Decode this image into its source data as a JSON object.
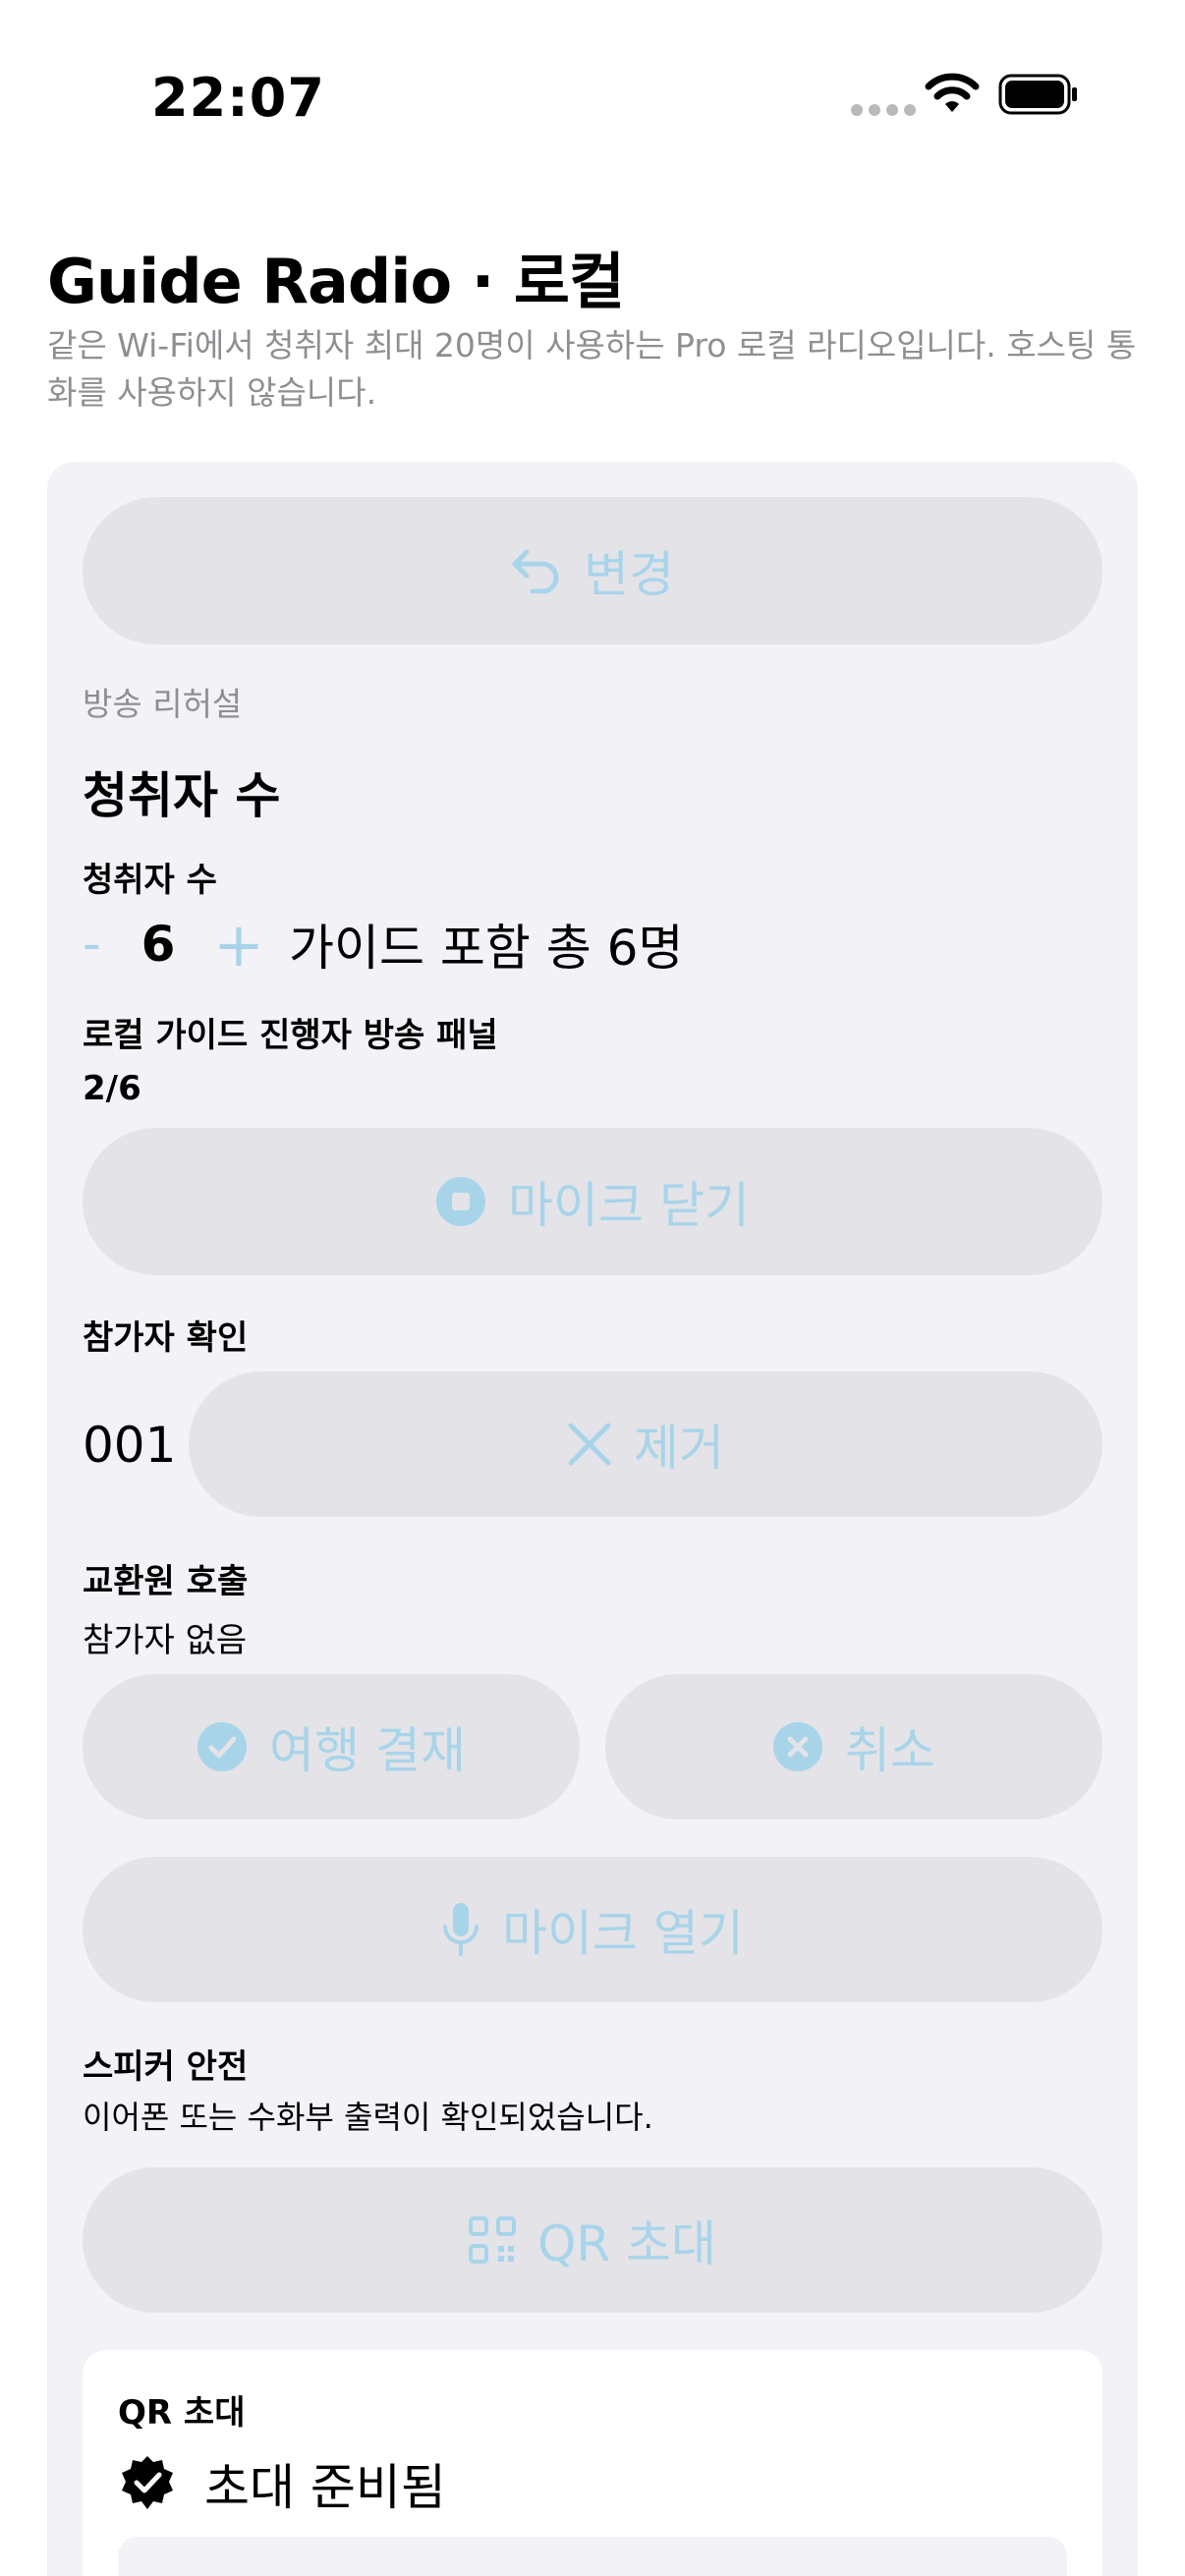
{
  "status_bar": {
    "time": "22:07"
  },
  "header": {
    "title": "Guide Radio · 로컬",
    "subtitle": "같은 Wi-Fi에서 청취자 최대 20명이 사용하는 Pro 로컬 라디오입니다. 호스팅 통화를 사용하지 않습니다."
  },
  "card": {
    "change_button": {
      "label": "변경",
      "icon": "undo-icon"
    },
    "rehearsal_caption": "방송 리허설",
    "listeners_title": "청취자 수",
    "listeners_label": "청취자 수",
    "stepper": {
      "minus": "-",
      "value": "6",
      "plus": "+",
      "total": "가이드 포함 총 6명"
    },
    "panel_label": "로컬 가이드 진행자 방송 패널",
    "panel_count": "2/6",
    "mic_close_button": {
      "label": "마이크 닫기",
      "icon": "stop-circle-icon"
    },
    "participant_check_label": "참가자 확인",
    "participant_id": "001",
    "remove_button": {
      "label": "제거",
      "icon": "close-icon"
    },
    "exchange_call_label": "교환원 호출",
    "exchange_call_value": "참가자 없음",
    "trip_payment_button": {
      "label": "여행 결재",
      "icon": "check-circle-icon"
    },
    "cancel_button": {
      "label": "취소",
      "icon": "x-circle-icon"
    },
    "mic_open_button": {
      "label": "마이크 열기",
      "icon": "microphone-icon"
    },
    "speaker_safety_label": "스피커 안전",
    "speaker_safety_value": "이어폰 또는 수화부 출력이 확인되었습니다.",
    "qr_invite_button": {
      "label": "QR 초대",
      "icon": "qr-code-icon"
    },
    "qr_panel": {
      "title": "QR 초대",
      "status": "초대 준비됨",
      "status_icon": "verified-badge-icon"
    }
  },
  "colors": {
    "accent_disabled": "#a8d4ea",
    "button_bg": "#e3e3e8",
    "card_bg": "#f2f2f7",
    "secondary_text": "#8e8e93"
  }
}
